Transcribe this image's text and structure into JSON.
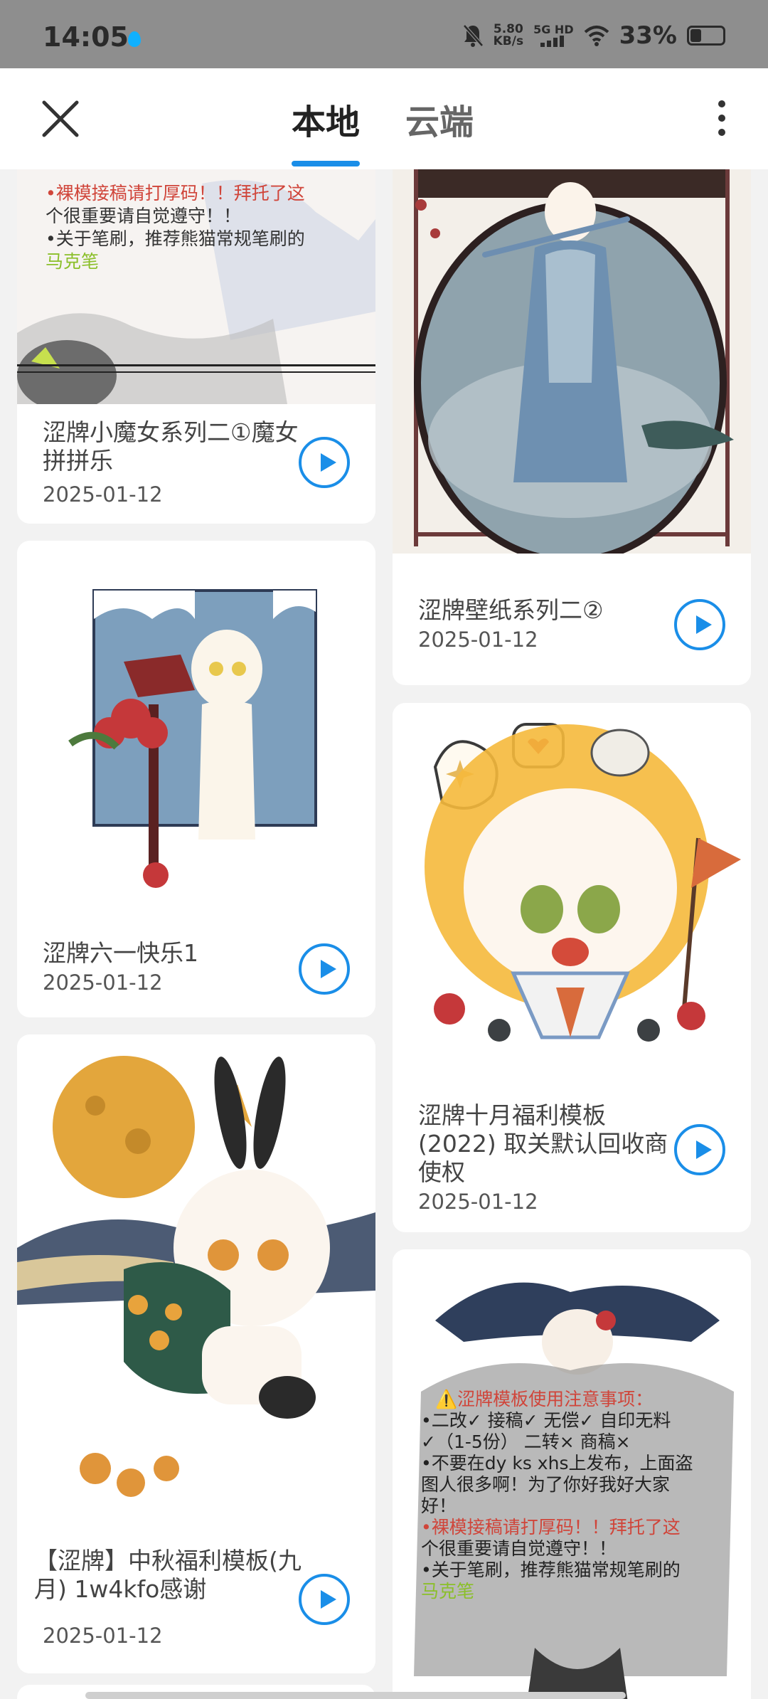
{
  "status_bar": {
    "time": "14:05",
    "speed_value": "5.80",
    "speed_unit": "KB/s",
    "network": "5G HD",
    "battery": "33%",
    "battery_level": 0.33,
    "icons": [
      "mute-bell-icon",
      "signal-icon",
      "wifi-icon",
      "battery-icon"
    ]
  },
  "header": {
    "tabs": [
      {
        "label": "本地",
        "active": true
      },
      {
        "label": "云端",
        "active": false
      }
    ],
    "accent": "#1a8ee8"
  },
  "cards": [
    {
      "title": "涩牌小魔女系列二①魔女拼拼乐",
      "date": "2025-01-12"
    },
    {
      "title": "涩牌壁纸系列二②",
      "date": "2025-01-12"
    },
    {
      "title": "涩牌六一快乐1",
      "date": "2025-01-12"
    },
    {
      "title": "涩牌十月福利模板(2022) 取关默认回收商使权",
      "date": "2025-01-12"
    },
    {
      "title": "【涩牌】中秋福利模板(九月) 1w4kfo感谢",
      "date": "2025-01-12"
    },
    {
      "title": "",
      "date": ""
    }
  ],
  "image_text": {
    "notice_lines_top": [
      "•裸模接稿请打厚码！！拜托了这",
      "个很重要请自觉遵守！！",
      "•关于笔刷，推荐熊猫常规笔刷的",
      "马克笔"
    ],
    "notice_lines_bottom": [
      "⚠️涩牌模板使用注意事项：",
      "•二改✓ 接稿✓ 无偿✓ 自印无料",
      "✓（1-5份） 二转× 商稿×",
      "•不要在dy ks xhs上发布，上面盗",
      "图人很多啊！为了你好我好大家",
      "好！",
      "•裸模接稿请打厚码！！拜托了这",
      "个很重要请自觉遵守！！",
      "•关于笔刷，推荐熊猫常规笔刷的",
      "马克笔"
    ]
  }
}
